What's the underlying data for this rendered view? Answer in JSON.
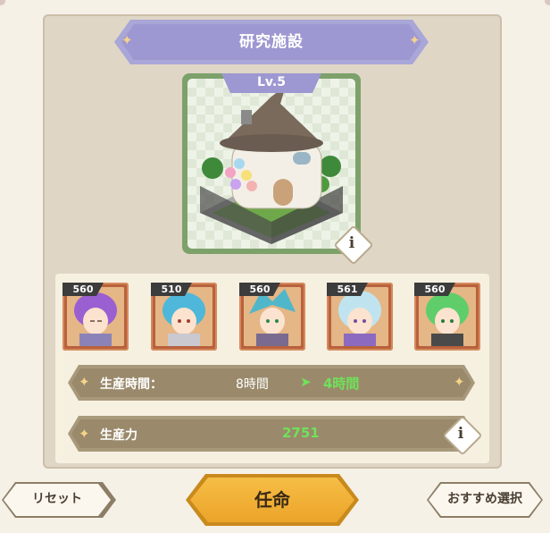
{
  "facility": {
    "title": "研究施設",
    "level_label": "Lv.5",
    "info_icon": "info-icon"
  },
  "characters": [
    {
      "level": "560",
      "hair_color": "#9a5fd0"
    },
    {
      "level": "510",
      "hair_color": "#4fb7d9"
    },
    {
      "level": "560",
      "hair_color": "#4fb7c9"
    },
    {
      "level": "561",
      "hair_color": "#bfe4ef"
    },
    {
      "level": "560",
      "hair_color": "#5fce6a"
    }
  ],
  "stats": {
    "production_time_label": "生産時間：",
    "production_time_value": "8時間",
    "production_time_new": "4時間",
    "production_power_label": "生産力",
    "production_power_value": "2751"
  },
  "buttons": {
    "reset": "リセット",
    "appoint": "任命",
    "recommended": "おすすめ選択"
  },
  "colors": {
    "title_banner": "#9d98d1",
    "highlight_green": "#6fe25a",
    "appoint_button": "#f0ae35"
  }
}
